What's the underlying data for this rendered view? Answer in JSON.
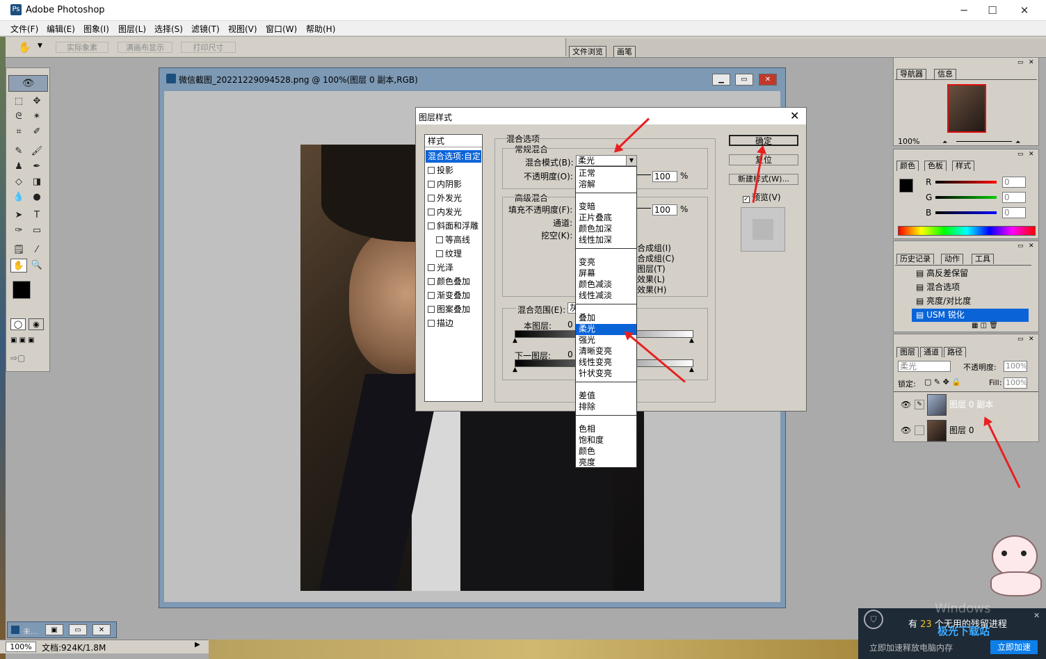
{
  "app": {
    "title": "Adobe Photoshop",
    "icon_label": "Ps"
  },
  "window_controls": {
    "minimize": "─",
    "maximize": "☐",
    "close": "✕"
  },
  "menubar": [
    "文件(F)",
    "编辑(E)",
    "图象(I)",
    "图层(L)",
    "选择(S)",
    "滤镜(T)",
    "视图(V)",
    "窗口(W)",
    "帮助(H)"
  ],
  "options": {
    "buttons": [
      "实际象素",
      "满画布显示",
      "打印尺寸"
    ],
    "tabs": [
      "文件浏览",
      "画笔"
    ]
  },
  "document": {
    "title": "微信截图_20221229094528.png @ 100%(图层 0 副本,RGB)",
    "zoom": "100%",
    "doc_info": "文档:924K/1.8M",
    "mini_title": "未..."
  },
  "dialog": {
    "title": "图层样式",
    "styles_header": "样式",
    "styles": [
      {
        "label": "混合选项:自定",
        "check": false,
        "selected": true
      },
      {
        "label": "投影",
        "check": true
      },
      {
        "label": "内阴影",
        "check": true
      },
      {
        "label": "外发光",
        "check": true
      },
      {
        "label": "内发光",
        "check": true
      },
      {
        "label": "斜面和浮雕",
        "check": true
      },
      {
        "label": "等高线",
        "check": true,
        "indent": true
      },
      {
        "label": "纹理",
        "check": true,
        "indent": true
      },
      {
        "label": "光泽",
        "check": true
      },
      {
        "label": "颜色叠加",
        "check": true
      },
      {
        "label": "渐变叠加",
        "check": true
      },
      {
        "label": "图案叠加",
        "check": true
      },
      {
        "label": "描边",
        "check": true
      }
    ],
    "blend_options": "混合选项",
    "general_blend": "常规混合",
    "blend_mode_label": "混合模式(B):",
    "blend_mode_value": "柔光",
    "opacity_label": "不透明度(O):",
    "opacity_value": "100",
    "percent": "%",
    "advanced_blend": "高级混合",
    "fill_opacity_label": "填充不透明度(F):",
    "fill_opacity_value": "100",
    "channels_label": "通道:",
    "knockout_label": "挖空(K):",
    "adv_right": [
      "合成组(I)",
      "合成组(C)",
      "图层(T)",
      "效果(L)",
      "效果(H)"
    ],
    "blend_range_label": "混合范围(E):",
    "blend_range_value": "灰",
    "this_layer": "本图层:",
    "this_layer_val": "0",
    "under_layer": "下一图层:",
    "under_layer_val": "0",
    "ok": "确定",
    "reset": "复位",
    "new_style": "新建样式(W)...",
    "preview": "预览(V)",
    "dropdown_groups": [
      [
        "正常",
        "溶解"
      ],
      [
        "变暗",
        "正片叠底",
        "颜色加深",
        "线性加深"
      ],
      [
        "变亮",
        "屏幕",
        "颜色减淡",
        "线性减淡"
      ],
      [
        "叠加",
        "柔光",
        "强光",
        "清晰变亮",
        "线性变亮",
        "针状变亮"
      ],
      [
        "差值",
        "排除"
      ],
      [
        "色相",
        "饱和度",
        "颜色",
        "亮度"
      ]
    ],
    "dropdown_selected": "柔光"
  },
  "navigator": {
    "tabs": [
      "导航器",
      "信息"
    ],
    "zoom": "100%"
  },
  "color_panel": {
    "tabs": [
      "颜色",
      "色板",
      "样式"
    ],
    "channels": [
      {
        "name": "R",
        "value": "0"
      },
      {
        "name": "G",
        "value": "0"
      },
      {
        "name": "B",
        "value": "0"
      }
    ]
  },
  "history_panel": {
    "tabs": [
      "历史记录",
      "动作",
      "工具"
    ],
    "items": [
      "高反差保留",
      "混合选项",
      "亮度/对比度",
      "USM 锐化"
    ],
    "selected": "USM 锐化"
  },
  "layers_panel": {
    "tabs": [
      "图层",
      "通道",
      "路径"
    ],
    "mode": "柔光",
    "opacity_label": "不透明度:",
    "opacity_value": "100%",
    "lock_label": "锁定:",
    "fill_label": "Fill:",
    "fill_value": "100%",
    "layers": [
      {
        "name": "图层 0 副本",
        "selected": true
      },
      {
        "name": "图层 0",
        "selected": false
      }
    ]
  },
  "notification": {
    "text_pre": "有",
    "count": "23",
    "text_post": "个无用的残留进程",
    "sub": "立即加速释放电脑内存",
    "button": "立即加速",
    "watermark": "Windows",
    "brand": "极光下载站"
  },
  "colors": {
    "accent": "#0a64d8",
    "arrow": "#e82020",
    "panel": "#d4d0c8",
    "docframe": "#7d99b4"
  }
}
